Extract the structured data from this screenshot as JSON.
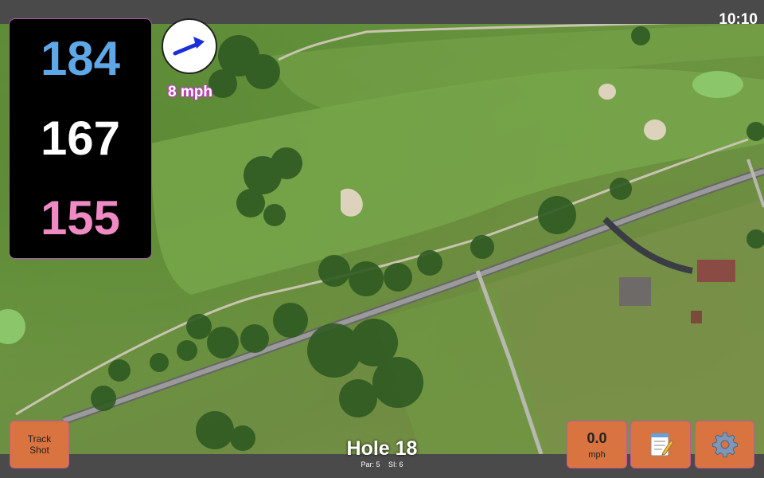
{
  "status": {
    "time": "10:10"
  },
  "distances": {
    "back": "184",
    "center": "167",
    "front": "155"
  },
  "wind": {
    "speed": "8 mph",
    "arrow_icon": "wind-direction-arrow-icon"
  },
  "buttons": {
    "track_shot": {
      "line1": "Track",
      "line2": "Shot"
    },
    "speed": {
      "value": "0.0",
      "unit": "mph"
    },
    "notes_icon": "notepad-icon",
    "settings_icon": "gear-icon"
  },
  "hole": {
    "title": "Hole 18",
    "par": "Par: 5",
    "si": "SI: 6"
  },
  "colors": {
    "back": "#5fa8e8",
    "center": "#ffffff",
    "front": "#f08ac4",
    "button": "#d9733f"
  }
}
